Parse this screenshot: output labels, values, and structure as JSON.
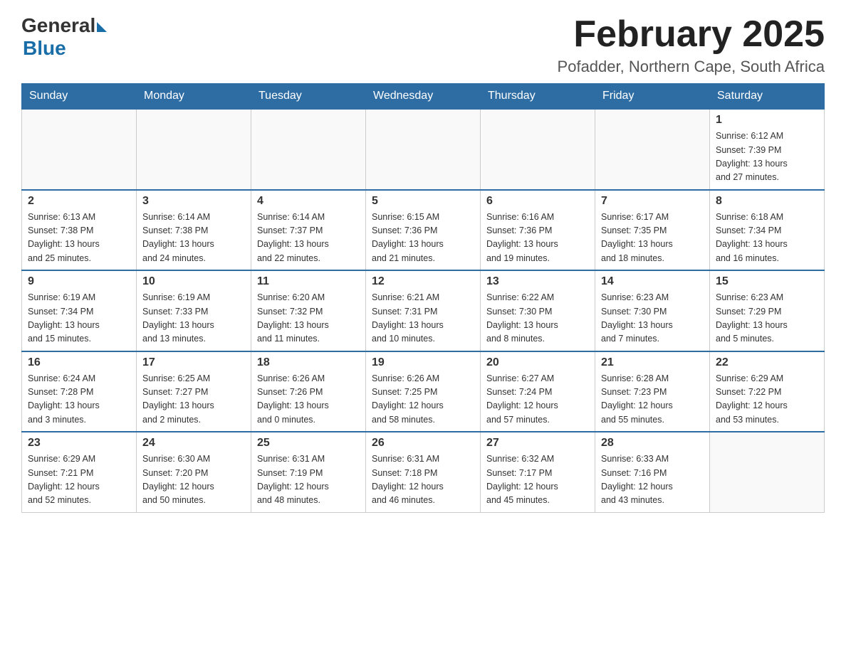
{
  "header": {
    "logo_general": "General",
    "logo_blue": "Blue",
    "month_title": "February 2025",
    "location": "Pofadder, Northern Cape, South Africa"
  },
  "weekdays": [
    "Sunday",
    "Monday",
    "Tuesday",
    "Wednesday",
    "Thursday",
    "Friday",
    "Saturday"
  ],
  "weeks": [
    [
      {
        "day": "",
        "info": ""
      },
      {
        "day": "",
        "info": ""
      },
      {
        "day": "",
        "info": ""
      },
      {
        "day": "",
        "info": ""
      },
      {
        "day": "",
        "info": ""
      },
      {
        "day": "",
        "info": ""
      },
      {
        "day": "1",
        "info": "Sunrise: 6:12 AM\nSunset: 7:39 PM\nDaylight: 13 hours\nand 27 minutes."
      }
    ],
    [
      {
        "day": "2",
        "info": "Sunrise: 6:13 AM\nSunset: 7:38 PM\nDaylight: 13 hours\nand 25 minutes."
      },
      {
        "day": "3",
        "info": "Sunrise: 6:14 AM\nSunset: 7:38 PM\nDaylight: 13 hours\nand 24 minutes."
      },
      {
        "day": "4",
        "info": "Sunrise: 6:14 AM\nSunset: 7:37 PM\nDaylight: 13 hours\nand 22 minutes."
      },
      {
        "day": "5",
        "info": "Sunrise: 6:15 AM\nSunset: 7:36 PM\nDaylight: 13 hours\nand 21 minutes."
      },
      {
        "day": "6",
        "info": "Sunrise: 6:16 AM\nSunset: 7:36 PM\nDaylight: 13 hours\nand 19 minutes."
      },
      {
        "day": "7",
        "info": "Sunrise: 6:17 AM\nSunset: 7:35 PM\nDaylight: 13 hours\nand 18 minutes."
      },
      {
        "day": "8",
        "info": "Sunrise: 6:18 AM\nSunset: 7:34 PM\nDaylight: 13 hours\nand 16 minutes."
      }
    ],
    [
      {
        "day": "9",
        "info": "Sunrise: 6:19 AM\nSunset: 7:34 PM\nDaylight: 13 hours\nand 15 minutes."
      },
      {
        "day": "10",
        "info": "Sunrise: 6:19 AM\nSunset: 7:33 PM\nDaylight: 13 hours\nand 13 minutes."
      },
      {
        "day": "11",
        "info": "Sunrise: 6:20 AM\nSunset: 7:32 PM\nDaylight: 13 hours\nand 11 minutes."
      },
      {
        "day": "12",
        "info": "Sunrise: 6:21 AM\nSunset: 7:31 PM\nDaylight: 13 hours\nand 10 minutes."
      },
      {
        "day": "13",
        "info": "Sunrise: 6:22 AM\nSunset: 7:30 PM\nDaylight: 13 hours\nand 8 minutes."
      },
      {
        "day": "14",
        "info": "Sunrise: 6:23 AM\nSunset: 7:30 PM\nDaylight: 13 hours\nand 7 minutes."
      },
      {
        "day": "15",
        "info": "Sunrise: 6:23 AM\nSunset: 7:29 PM\nDaylight: 13 hours\nand 5 minutes."
      }
    ],
    [
      {
        "day": "16",
        "info": "Sunrise: 6:24 AM\nSunset: 7:28 PM\nDaylight: 13 hours\nand 3 minutes."
      },
      {
        "day": "17",
        "info": "Sunrise: 6:25 AM\nSunset: 7:27 PM\nDaylight: 13 hours\nand 2 minutes."
      },
      {
        "day": "18",
        "info": "Sunrise: 6:26 AM\nSunset: 7:26 PM\nDaylight: 13 hours\nand 0 minutes."
      },
      {
        "day": "19",
        "info": "Sunrise: 6:26 AM\nSunset: 7:25 PM\nDaylight: 12 hours\nand 58 minutes."
      },
      {
        "day": "20",
        "info": "Sunrise: 6:27 AM\nSunset: 7:24 PM\nDaylight: 12 hours\nand 57 minutes."
      },
      {
        "day": "21",
        "info": "Sunrise: 6:28 AM\nSunset: 7:23 PM\nDaylight: 12 hours\nand 55 minutes."
      },
      {
        "day": "22",
        "info": "Sunrise: 6:29 AM\nSunset: 7:22 PM\nDaylight: 12 hours\nand 53 minutes."
      }
    ],
    [
      {
        "day": "23",
        "info": "Sunrise: 6:29 AM\nSunset: 7:21 PM\nDaylight: 12 hours\nand 52 minutes."
      },
      {
        "day": "24",
        "info": "Sunrise: 6:30 AM\nSunset: 7:20 PM\nDaylight: 12 hours\nand 50 minutes."
      },
      {
        "day": "25",
        "info": "Sunrise: 6:31 AM\nSunset: 7:19 PM\nDaylight: 12 hours\nand 48 minutes."
      },
      {
        "day": "26",
        "info": "Sunrise: 6:31 AM\nSunset: 7:18 PM\nDaylight: 12 hours\nand 46 minutes."
      },
      {
        "day": "27",
        "info": "Sunrise: 6:32 AM\nSunset: 7:17 PM\nDaylight: 12 hours\nand 45 minutes."
      },
      {
        "day": "28",
        "info": "Sunrise: 6:33 AM\nSunset: 7:16 PM\nDaylight: 12 hours\nand 43 minutes."
      },
      {
        "day": "",
        "info": ""
      }
    ]
  ]
}
